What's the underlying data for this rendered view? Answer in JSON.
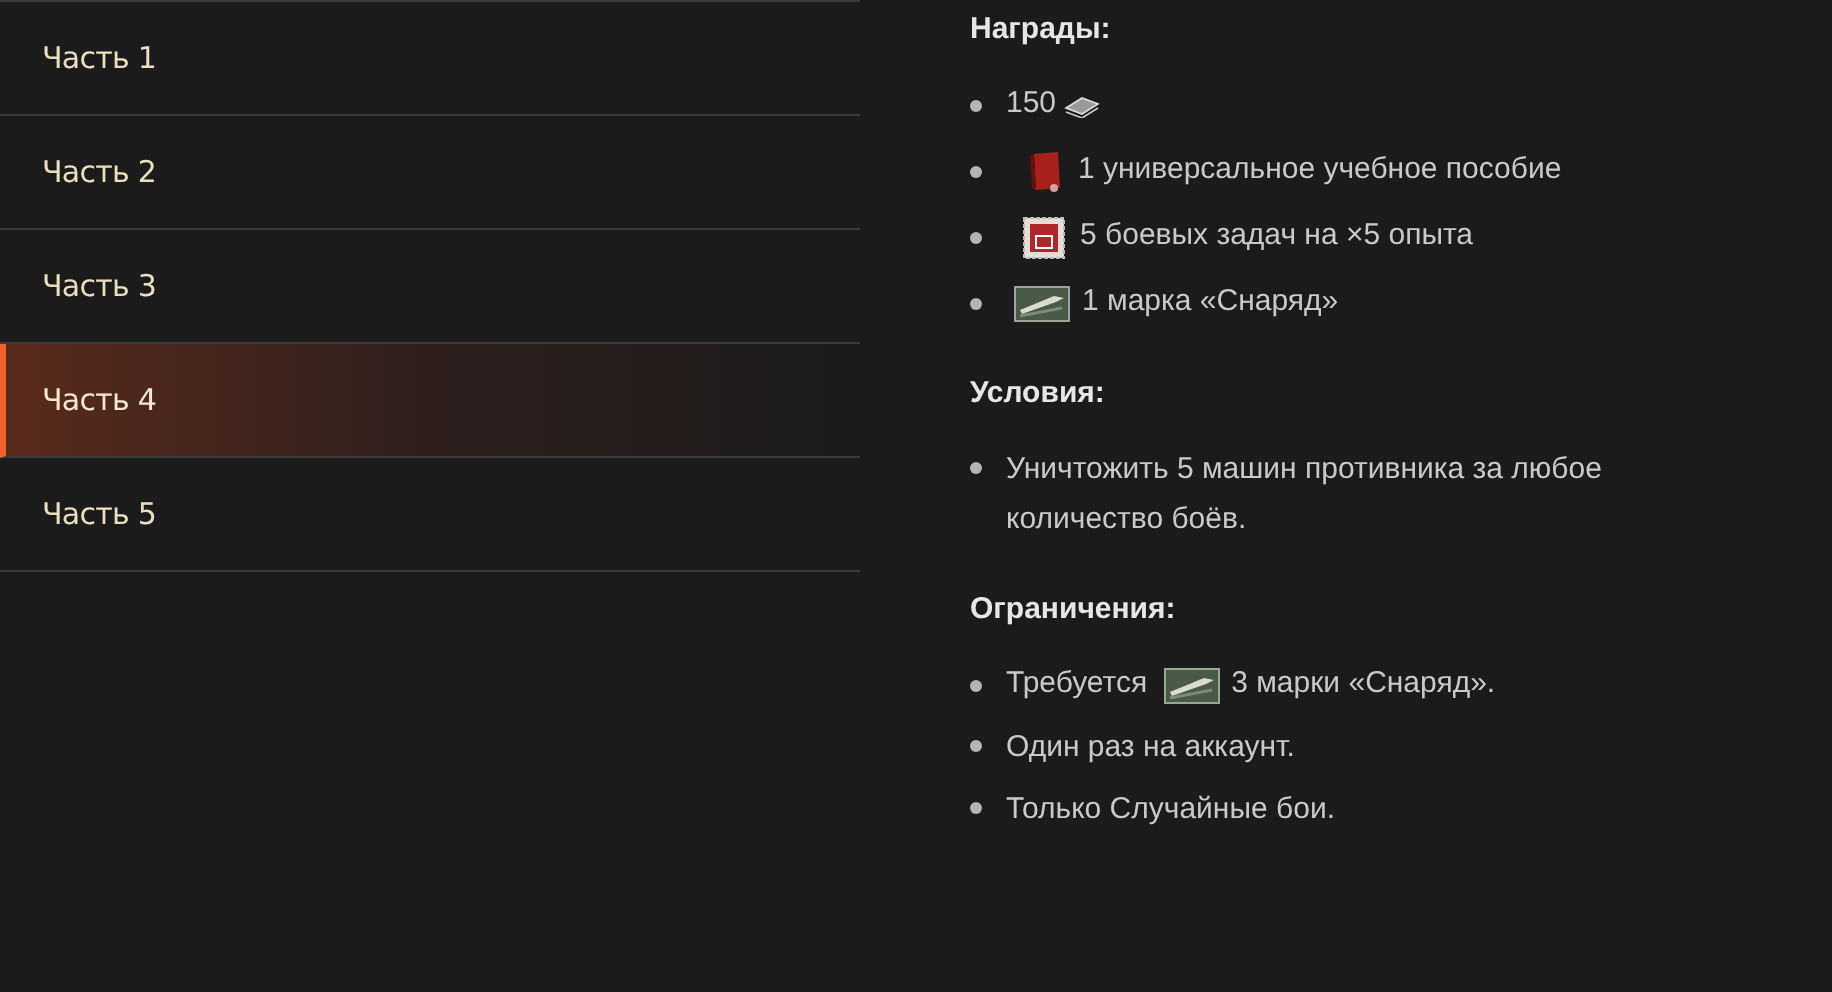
{
  "parts": [
    {
      "label": "Часть 1",
      "selected": false
    },
    {
      "label": "Часть 2",
      "selected": false
    },
    {
      "label": "Часть 3",
      "selected": false
    },
    {
      "label": "Часть 4",
      "selected": true
    },
    {
      "label": "Часть 5",
      "selected": false
    }
  ],
  "rewards": {
    "title": "Награды:",
    "items": [
      {
        "kind": "bonds",
        "text": "150"
      },
      {
        "kind": "book",
        "text": "1 универсальное учебное пособие"
      },
      {
        "kind": "stamp",
        "text": "5 боевых задач на ×5 опыта"
      },
      {
        "kind": "shell",
        "text": "1 марка «Снаряд»"
      }
    ]
  },
  "conditions": {
    "title": "Условия:",
    "items": [
      {
        "kind": "plain",
        "text": "Уничтожить 5 машин противника за любое количество боёв."
      }
    ]
  },
  "restrictions": {
    "title": "Ограничения:",
    "items": [
      {
        "kind": "requirement",
        "before": "Требуется",
        "text": "3 марки «Снаряд»."
      },
      {
        "kind": "plain",
        "text": "Один раз на аккаунт."
      },
      {
        "kind": "plain",
        "text": "Только Случайные бои."
      }
    ]
  }
}
